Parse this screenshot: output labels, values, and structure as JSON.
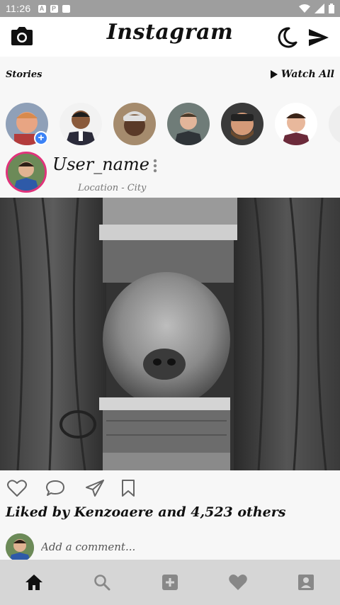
{
  "status_bar": {
    "time": "11:26"
  },
  "app": {
    "title": "Instagram"
  },
  "stories": {
    "label": "Stories",
    "watch_all_label": "Watch All"
  },
  "post": {
    "username": "User_name",
    "location": "Location - City",
    "likes_text": "Liked by Kenzoaere and 4,523 others"
  },
  "comment": {
    "placeholder": "Add a comment..."
  },
  "colors": {
    "story_ring": "#e0337b",
    "add_badge": "#3b82f6",
    "nav_background": "#d6d6d6",
    "status_bar": "#9e9e9e"
  },
  "icons": {
    "camera": "camera-icon",
    "theme": "moon-icon",
    "direct": "send-icon",
    "like": "heart-outline-icon",
    "comment": "comment-icon",
    "share": "paper-plane-icon",
    "save": "bookmark-icon",
    "nav": [
      "home-icon",
      "search-icon",
      "add-box-icon",
      "heart-icon",
      "profile-icon"
    ]
  }
}
